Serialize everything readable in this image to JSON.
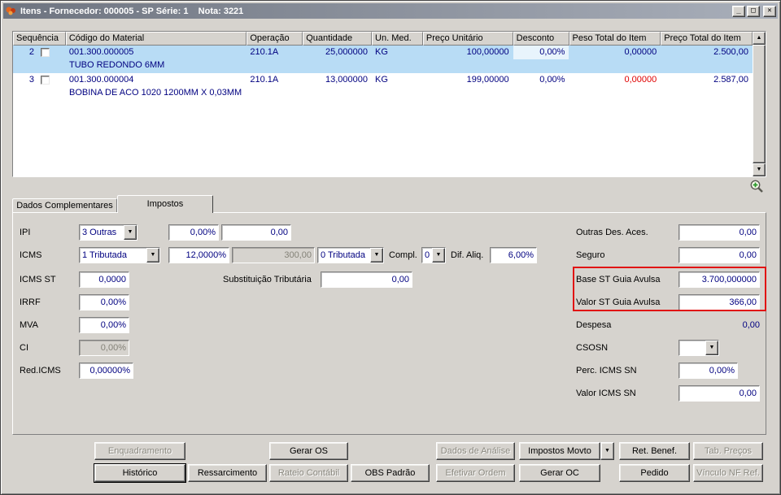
{
  "window": {
    "title": "Itens - Fornecedor: 000005 - SP Série: 1    Nota: 3221",
    "controls": {
      "minimize": "_",
      "maximize": "□",
      "close": "✕"
    }
  },
  "grid": {
    "columns": [
      "Sequência",
      "Código do Material",
      "Operação",
      "Quantidade",
      "Un. Med.",
      "Preço Unitário",
      "Desconto",
      "Peso Total do Item",
      "Preço Total do Item"
    ],
    "rows": [
      {
        "seq": "2",
        "code": "001.300.000005",
        "desc": "TUBO REDONDO 6MM",
        "op": "210.1A",
        "qty": "25,000000",
        "um": "KG",
        "unit_price": "100,00000",
        "discount": "0,00%",
        "weight": "0,00000",
        "total": "2.500,00"
      },
      {
        "seq": "3",
        "code": "001.300.000004",
        "desc": "BOBINA DE ACO 1020 1200MM X 0,03MM",
        "op": "210.1A",
        "qty": "13,000000",
        "um": "KG",
        "unit_price": "199,00000",
        "discount": "0,00%",
        "weight": "0,00000",
        "total": "2.587,00"
      }
    ]
  },
  "tabs": {
    "dados": "Dados Complementares",
    "impostos": "Impostos"
  },
  "form": {
    "ipi": {
      "label": "IPI",
      "tipo": "3 Outras",
      "aliq": "0,00%",
      "valor": "0,00"
    },
    "icms": {
      "label": "ICMS",
      "tipo": "1 Tributada",
      "aliq": "12,0000%",
      "base": "300,00",
      "tipo2": "0 Tributada",
      "compl_label": "Compl.",
      "compl": "0",
      "dif_label": "Dif. Aliq.",
      "dif": "6,00%"
    },
    "icms_st": {
      "label": "ICMS ST",
      "valor": "0,0000",
      "st_label": "Substituição Tributária",
      "st_valor": "0,00"
    },
    "irrf": {
      "label": "IRRF",
      "valor": "0,00%"
    },
    "mva": {
      "label": "MVA",
      "valor": "0,00%"
    },
    "ci": {
      "label": "CI",
      "valor": "0,00%"
    },
    "red_icms": {
      "label": "Red.ICMS",
      "valor": "0,00000%"
    },
    "outras": {
      "label": "Outras Des. Aces.",
      "valor": "0,00"
    },
    "seguro": {
      "label": "Seguro",
      "valor": "0,00"
    },
    "base_st": {
      "label": "Base ST Guia Avulsa",
      "valor": "3.700,000000"
    },
    "valor_st": {
      "label": "Valor ST Guia Avulsa",
      "valor": "366,00"
    },
    "despesa": {
      "label": "Despesa",
      "valor": "0,00"
    },
    "csosn": {
      "label": "CSOSN",
      "valor": ""
    },
    "perc_icms_sn": {
      "label": "Perc. ICMS SN",
      "valor": "0,00%"
    },
    "valor_icms_sn": {
      "label": "Valor ICMS SN",
      "valor": "0,00"
    }
  },
  "buttons": {
    "enquadramento": "Enquadramento",
    "gerar_os": "Gerar OS",
    "dados_analise": "Dados de Análise",
    "impostos_movto": "Impostos Movto",
    "ret_benef": "Ret. Benef.",
    "tab_precos": "Tab. Preços",
    "historico": "Histórico",
    "ressarcimento": "Ressarcimento",
    "rateio": "Rateio Contábil",
    "obs": "OBS Padrão",
    "efetivar": "Efetivar Ordem",
    "gerar_oc": "Gerar OC",
    "pedido": "Pedido",
    "vinculo": "Vínculo NF Ref."
  },
  "icons": {
    "combo_arrow": "▼",
    "scroll_up": "▲",
    "scroll_down": "▼",
    "dropdown_arrow": "▼"
  },
  "colors": {
    "window_bg": "#d6d3ce",
    "selection": "#b8dcf5",
    "value_text": "#000080",
    "negative": "#e00000",
    "highlight_box": "#e11414",
    "titlebar_from": "#6e7480",
    "titlebar_to": "#a9afba"
  }
}
